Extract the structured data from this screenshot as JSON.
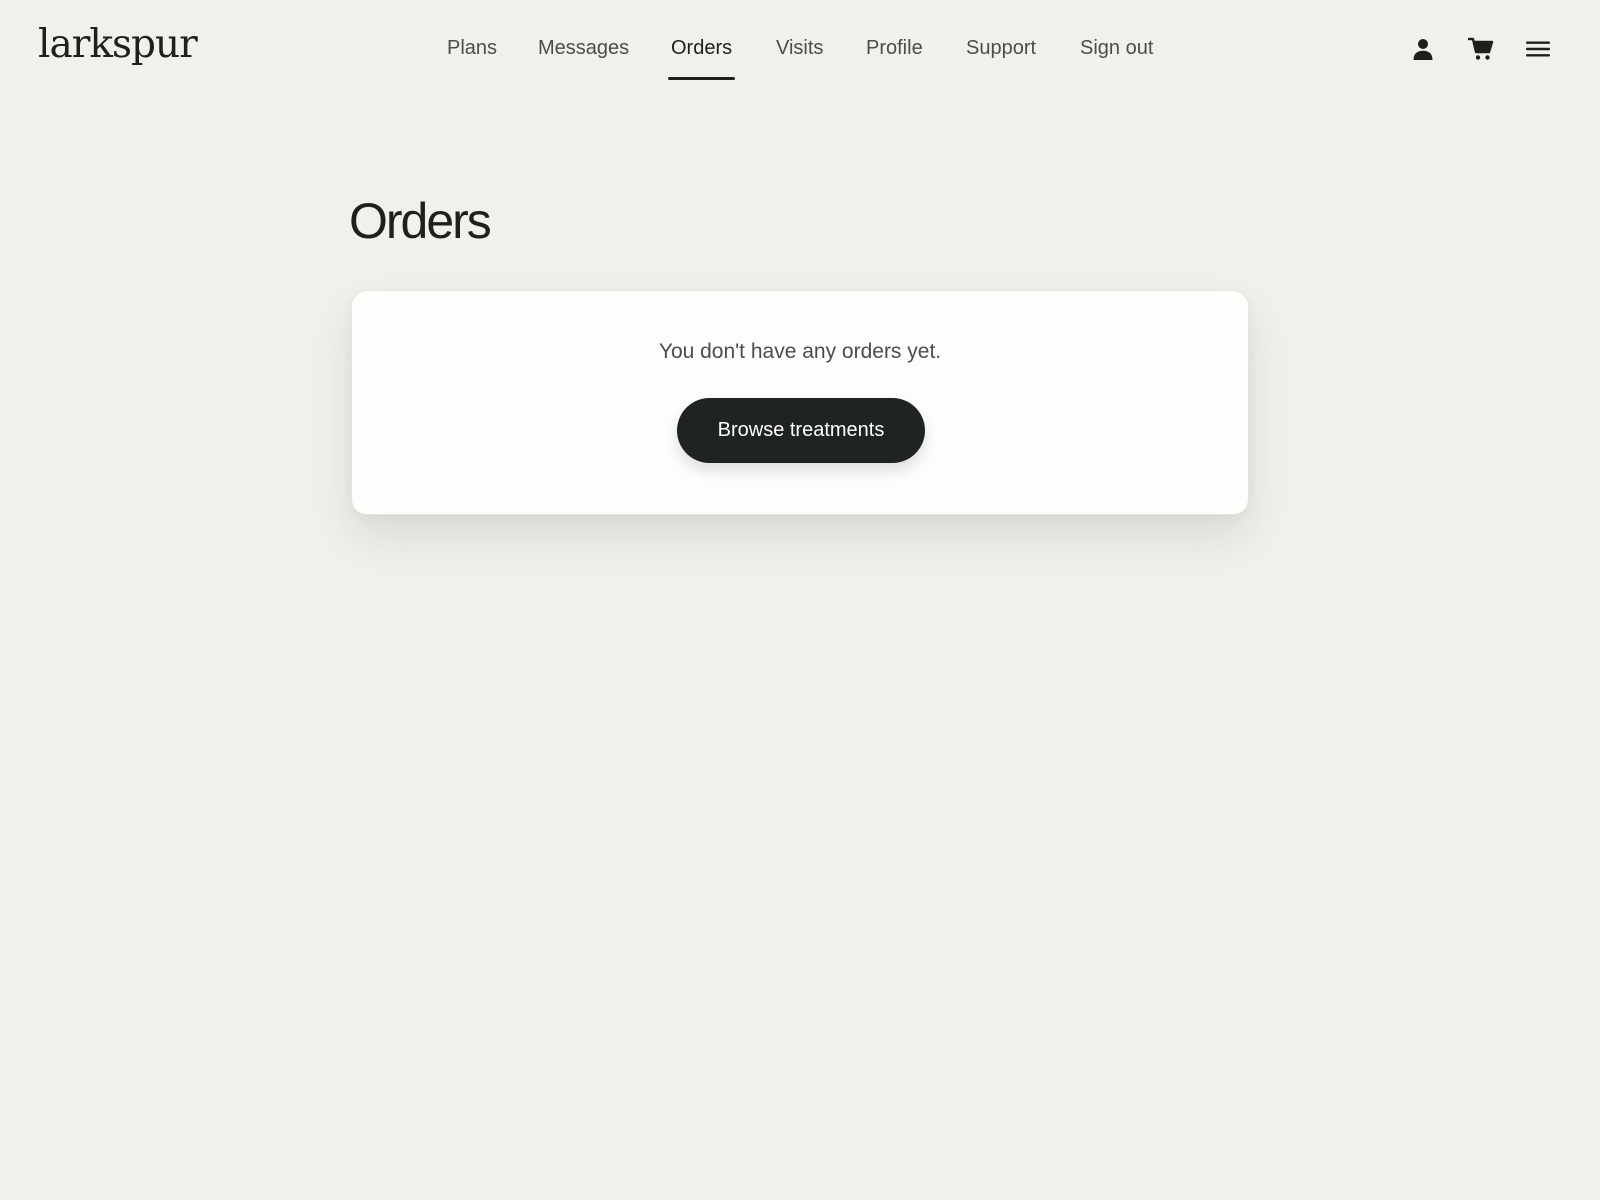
{
  "header": {
    "logo": "larkspur",
    "nav": [
      {
        "label": "Plans"
      },
      {
        "label": "Messages"
      },
      {
        "label": "Orders",
        "active": true
      },
      {
        "label": "Visits"
      },
      {
        "label": "Profile"
      },
      {
        "label": "Support"
      },
      {
        "label": "Sign out"
      }
    ],
    "icons": [
      "account-icon",
      "cart-icon",
      "menu-icon"
    ]
  },
  "main": {
    "title": "Orders",
    "empty_state": {
      "message": "You don't have any orders yet.",
      "button_label": "Browse treatments"
    }
  },
  "colors": {
    "background": "#f1f0eb",
    "card": "#fdfdfb",
    "text": "#1d201d",
    "button": "#1f2420"
  }
}
